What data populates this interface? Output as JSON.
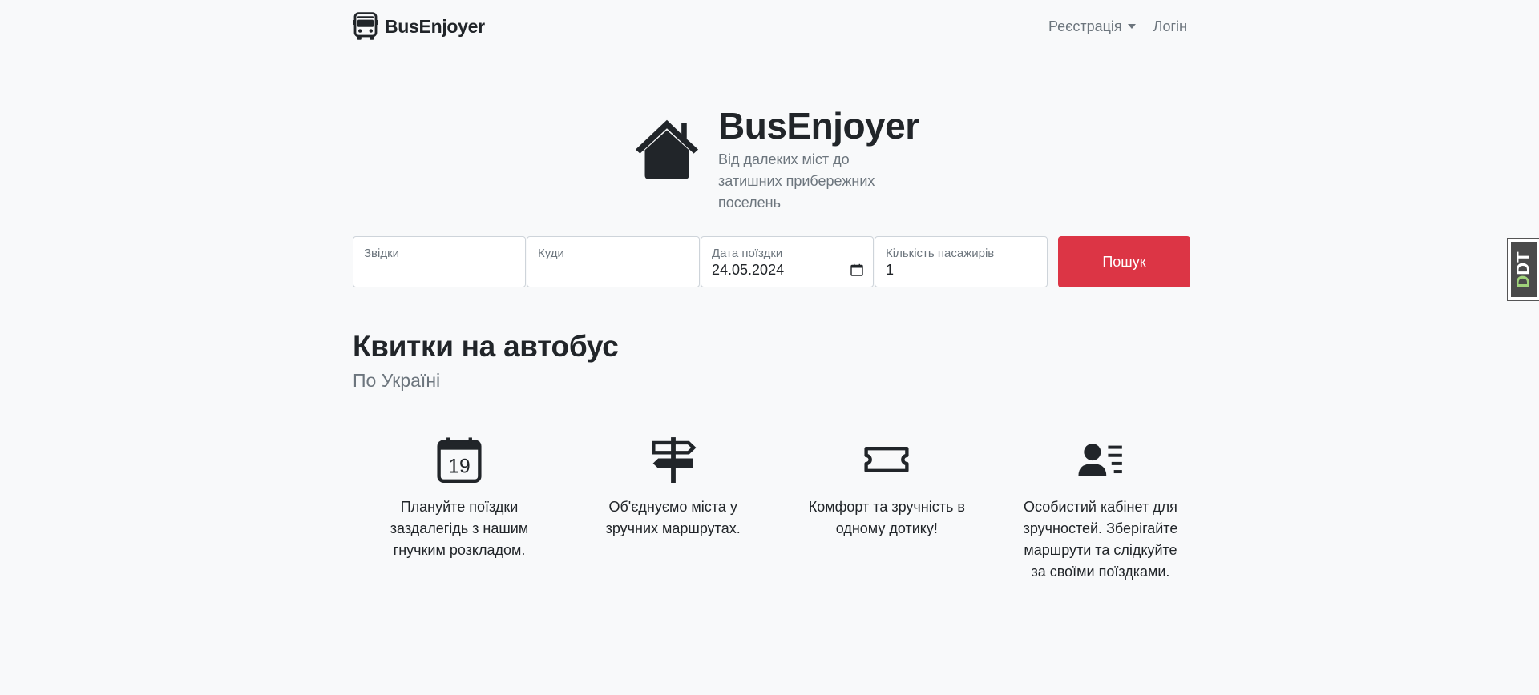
{
  "navbar": {
    "brand": "BusEnjoyer",
    "register": "Реєстрація",
    "login": "Логін"
  },
  "hero": {
    "title": "BusEnjoyer",
    "subtitle": "Від далеких міст до затишних прибережних поселень"
  },
  "search": {
    "from_label": "Звідки",
    "from_value": "",
    "to_label": "Куди",
    "to_value": "",
    "date_label": "Дата поїздки",
    "date_value": "24.05.2024",
    "passengers_label": "Кількість пасажирів",
    "passengers_value": "1",
    "button": "Пошук"
  },
  "section": {
    "title": "Квитки на автобус",
    "subtitle": "По Україні"
  },
  "features": [
    {
      "icon": "calendar-icon",
      "day": "19",
      "text": "Плануйте поїздки заздалегідь з нашим гнучким розкладом."
    },
    {
      "icon": "signpost-icon",
      "text": "Об'єднуємо міста у зручних маршрутах."
    },
    {
      "icon": "ticket-icon",
      "text": "Комфорт та зручність в одному дотику!"
    },
    {
      "icon": "person-lines-icon",
      "text": "Особистий кабінет для зручностей. Зберігайте маршрути та слідкуйте за своїми поїздками."
    }
  ],
  "side_badge": {
    "text_a": "D",
    "text_b": "DT"
  },
  "colors": {
    "accent": "#dc3545",
    "background": "#f8f9fa",
    "text": "#212529",
    "muted": "#6c757d"
  }
}
